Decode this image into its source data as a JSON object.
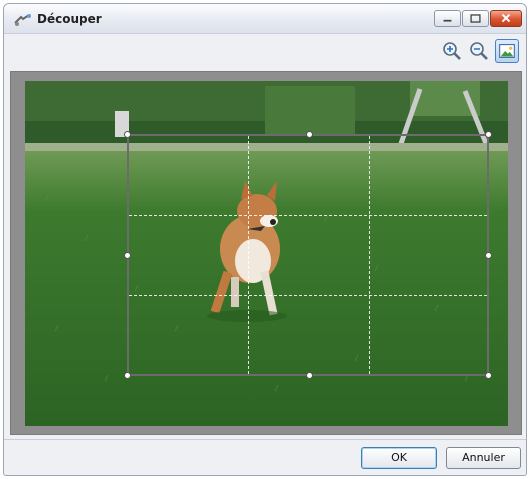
{
  "window": {
    "title": "Découper",
    "controls": {
      "minimize_icon": "minimize-icon",
      "maximize_icon": "maximize-icon",
      "close_icon": "close-icon"
    }
  },
  "toolbar": {
    "tools": [
      {
        "name": "zoom-in",
        "icon": "magnifier-plus-icon"
      },
      {
        "name": "zoom-out",
        "icon": "magnifier-minus-icon"
      },
      {
        "name": "fit-image",
        "icon": "image-icon",
        "active": true
      }
    ]
  },
  "preview": {
    "image": "photo-dog-on-grass",
    "crop_overlay": {
      "guides": "rule-of-thirds",
      "handles": 8
    }
  },
  "buttons": {
    "ok_label": "OK",
    "cancel_label": "Annuler"
  },
  "colors": {
    "accent": "#4a7fc0",
    "close_button": "#d9542f",
    "frame_bg": "#8e8e8e"
  }
}
